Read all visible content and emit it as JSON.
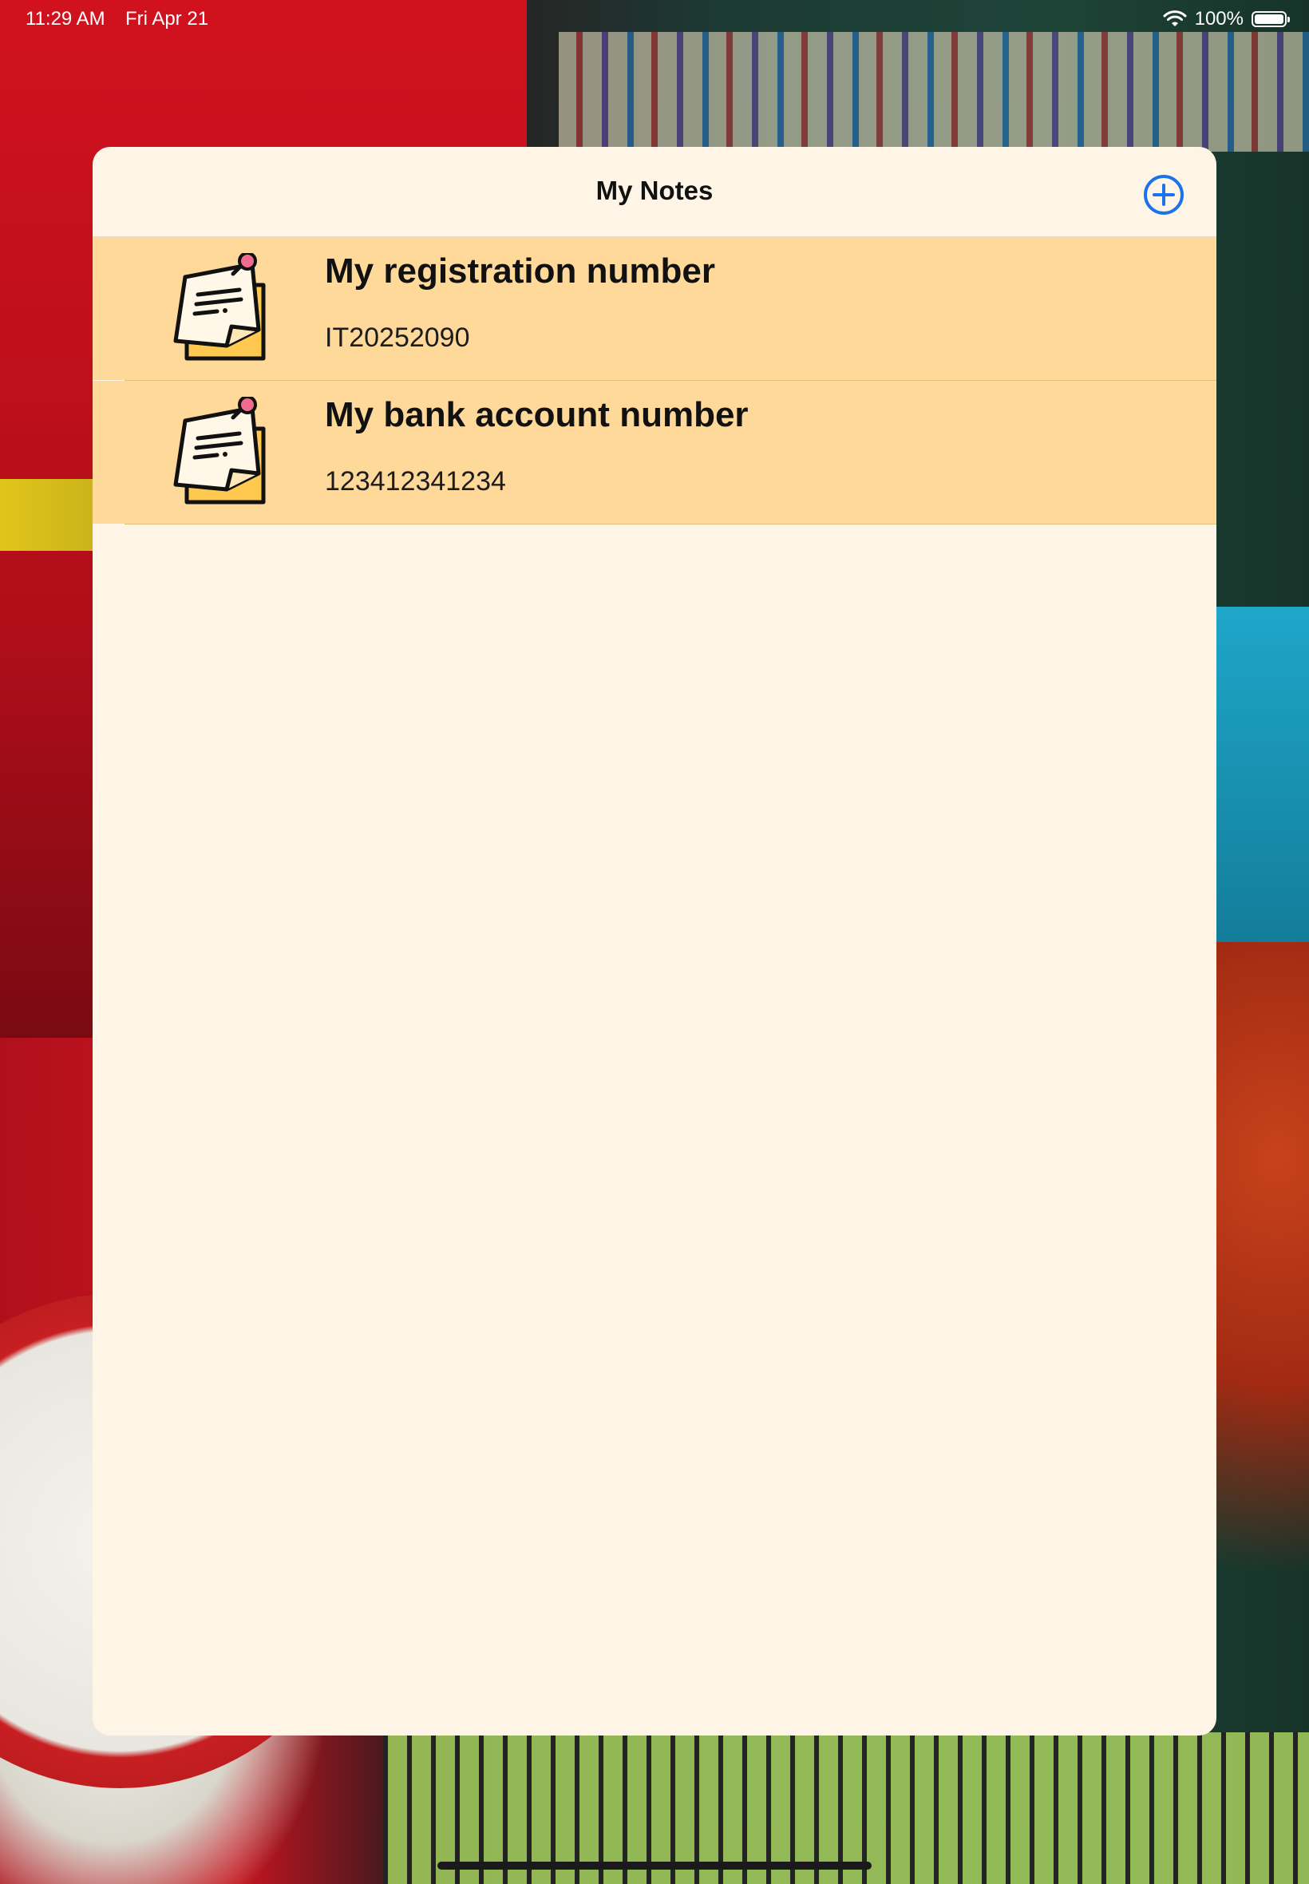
{
  "status_bar": {
    "time": "11:29 AM",
    "date": "Fri Apr 21",
    "battery": "100%",
    "icons": [
      "wifi-icon",
      "battery-icon"
    ]
  },
  "header": {
    "title": "My Notes",
    "add_icon": "plus-circle-icon"
  },
  "notes": [
    {
      "title": "My registration number",
      "body": "IT20252090",
      "icon": "sticky-note-icon"
    },
    {
      "title": "My bank account number",
      "body": "123412341234",
      "icon": "sticky-note-icon"
    }
  ],
  "colors": {
    "accent": "#1a73e8",
    "sheet_background": "#fff5e6",
    "row_background": "#ffd99a",
    "note_paper": "#ffc94f",
    "pin": "#f06b8e"
  }
}
